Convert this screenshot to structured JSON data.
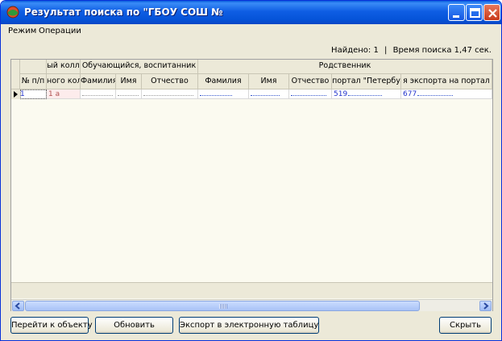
{
  "window": {
    "title": "Результат поиска по  \"ГБОУ СОШ №",
    "colors": {
      "titlebar": "#0553d8",
      "close_button": "#c8391b",
      "link_text": "#2233cc"
    }
  },
  "menu": {
    "items": [
      "Режим",
      "Операции"
    ]
  },
  "search_info": {
    "found": "Найдено: 1",
    "separator": "|",
    "time": "Время поиска 1,47 сек."
  },
  "grid": {
    "group_headers": {
      "class_partial": "ый колл",
      "student": "Обучающийся, воспитанник",
      "relative": "Родственник"
    },
    "columns": [
      "№ п/п",
      "ного кол",
      "Фамилия",
      "Имя",
      "Отчество",
      "Фамилия",
      "Имя",
      "Отчество",
      "портал \"Петербу",
      "я экспорта на портал \"П"
    ],
    "row": {
      "num": "1",
      "class": "1 а",
      "phone1": "519",
      "phone2": "677"
    }
  },
  "buttons": {
    "goto": "Перейти к объекту",
    "refresh": "Обновить",
    "export": "Экспорт в электронную таблицу",
    "hide": "Скрыть"
  }
}
